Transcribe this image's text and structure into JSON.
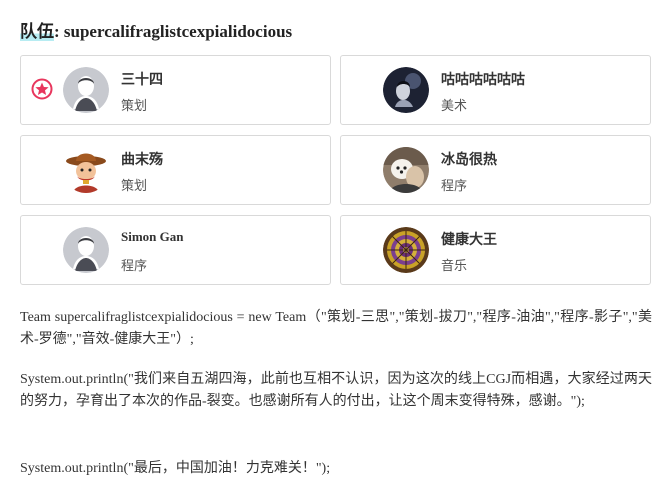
{
  "team": {
    "label": "队伍",
    "name": ": supercalifraglistcexpialidocious"
  },
  "members": [
    {
      "name": "三十四",
      "role": "策划",
      "avatar": "default-avatar-icon",
      "leader": true
    },
    {
      "name": "咕咕咕咕咕咕",
      "role": "美术",
      "avatar": "photo-avatar-dark"
    },
    {
      "name": "曲末殇",
      "role": "策划",
      "avatar": "cowboy-avatar"
    },
    {
      "name": "冰岛很热",
      "role": "程序",
      "avatar": "dog-photo-avatar"
    },
    {
      "name": "Simon Gan",
      "role": "程序",
      "avatar": "default-avatar-icon"
    },
    {
      "name": "健康大王",
      "role": "音乐",
      "avatar": "mandala-avatar"
    }
  ],
  "code": {
    "line1": "Team supercalifraglistcexpialidocious = new Team（\"策划-三思\",\"策划-拔刀\",\"程序-油油\",\"程序-影子\",\"美术-罗德\",\"音效-健康大王\"）;",
    "line2": "System.out.println(\"我们来自五湖四海，此前也互相不认识，因为这次的线上CGJ而相遇，大家经过两天的努力，孕育出了本次的作品-裂变。也感谢所有人的付出，让这个周末变得特殊，感谢。\");",
    "line3": "System.out.println(\"最后，中国加油！力克难关！\");"
  },
  "colors": {
    "leader_badge": "#e8365d",
    "card_border": "#d9d9d9",
    "title_highlight": "#b7ecf2"
  }
}
